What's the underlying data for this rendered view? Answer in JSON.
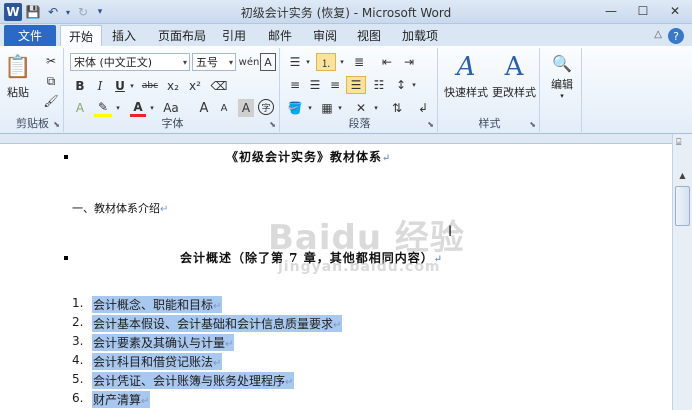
{
  "window": {
    "title": "初级会计实务 (恢复) - Microsoft Word",
    "app_icon": "W",
    "controls": [
      "minimize-icon",
      "maximize-icon",
      "close-icon"
    ]
  },
  "quick_access": [
    "save-icon",
    "undo-icon",
    "redo-icon",
    "customize-icon"
  ],
  "tabs": {
    "file": "文件",
    "items": [
      "开始",
      "插入",
      "页面布局",
      "引用",
      "邮件",
      "审阅",
      "视图",
      "加载项"
    ],
    "active": "开始"
  },
  "ribbon": {
    "clipboard": {
      "label": "剪贴板",
      "paste": "粘贴"
    },
    "font": {
      "label": "字体",
      "font_name": "宋体 (中文正文)",
      "font_size": "五号",
      "grow": "A",
      "shrink": "A",
      "aa": "Aa",
      "bold": "B",
      "italic": "I",
      "underline": "U",
      "strike": "abc",
      "sub": "x₂",
      "sup": "x²",
      "color_a": "A",
      "phonetic": "wén",
      "char_border": "A",
      "char_shade": "A",
      "enclose": "字"
    },
    "paragraph": {
      "label": "段落"
    },
    "styles": {
      "label": "样式",
      "quick": "快速样式",
      "change": "更改样式"
    },
    "editing": {
      "label": "编辑",
      "text": "编辑"
    }
  },
  "document": {
    "title": "《初级会计实务》教材体系",
    "section": "一、教材体系介绍",
    "chapter_heading": "会计概述（除了第 7 章，其他都相同内容）",
    "list": [
      {
        "num": "1.",
        "text": "会计概念、职能和目标"
      },
      {
        "num": "2.",
        "text": "会计基本假设、会计基础和会计信息质量要求"
      },
      {
        "num": "3.",
        "text": "会计要素及其确认与计量"
      },
      {
        "num": "4.",
        "text": "会计科目和借贷记账法"
      },
      {
        "num": "5.",
        "text": "会计凭证、会计账簿与账务处理程序"
      },
      {
        "num": "6.",
        "text": "财产清算"
      }
    ],
    "para_mark": "↵"
  },
  "watermark": {
    "main": "Baidu 经验",
    "sub": "jingyan.baidu.com"
  }
}
